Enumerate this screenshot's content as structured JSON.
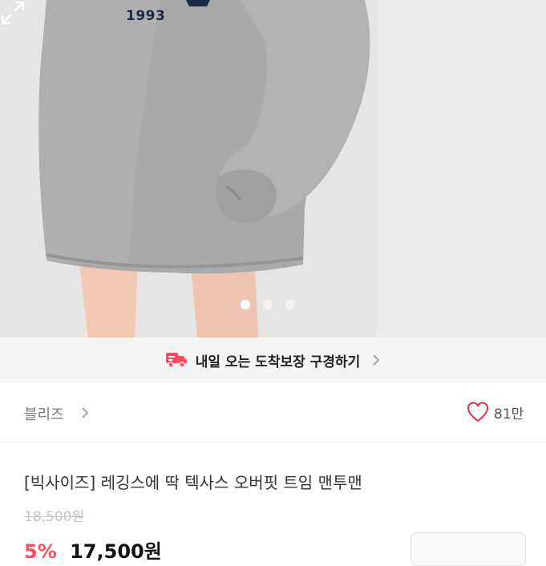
{
  "photo": {
    "print_text": "1993",
    "slide_count": 3,
    "active_slide": 1,
    "expand_icon": "expand-icon"
  },
  "delivery": {
    "text": "내일 오는 도착보장 구경하기",
    "icon": "delivery-truck-icon",
    "accent": "#ff4b5c"
  },
  "shop": {
    "name": "블리즈",
    "likes": "81만",
    "like_icon": "heart-icon",
    "like_color": "#e0303f"
  },
  "product": {
    "title": "[빅사이즈] 레깅스에 딱 텍사스 오버핏 트임 맨투맨",
    "original_price": "18,500원",
    "discount_rate": "5%",
    "sale_price": "17,500원"
  }
}
